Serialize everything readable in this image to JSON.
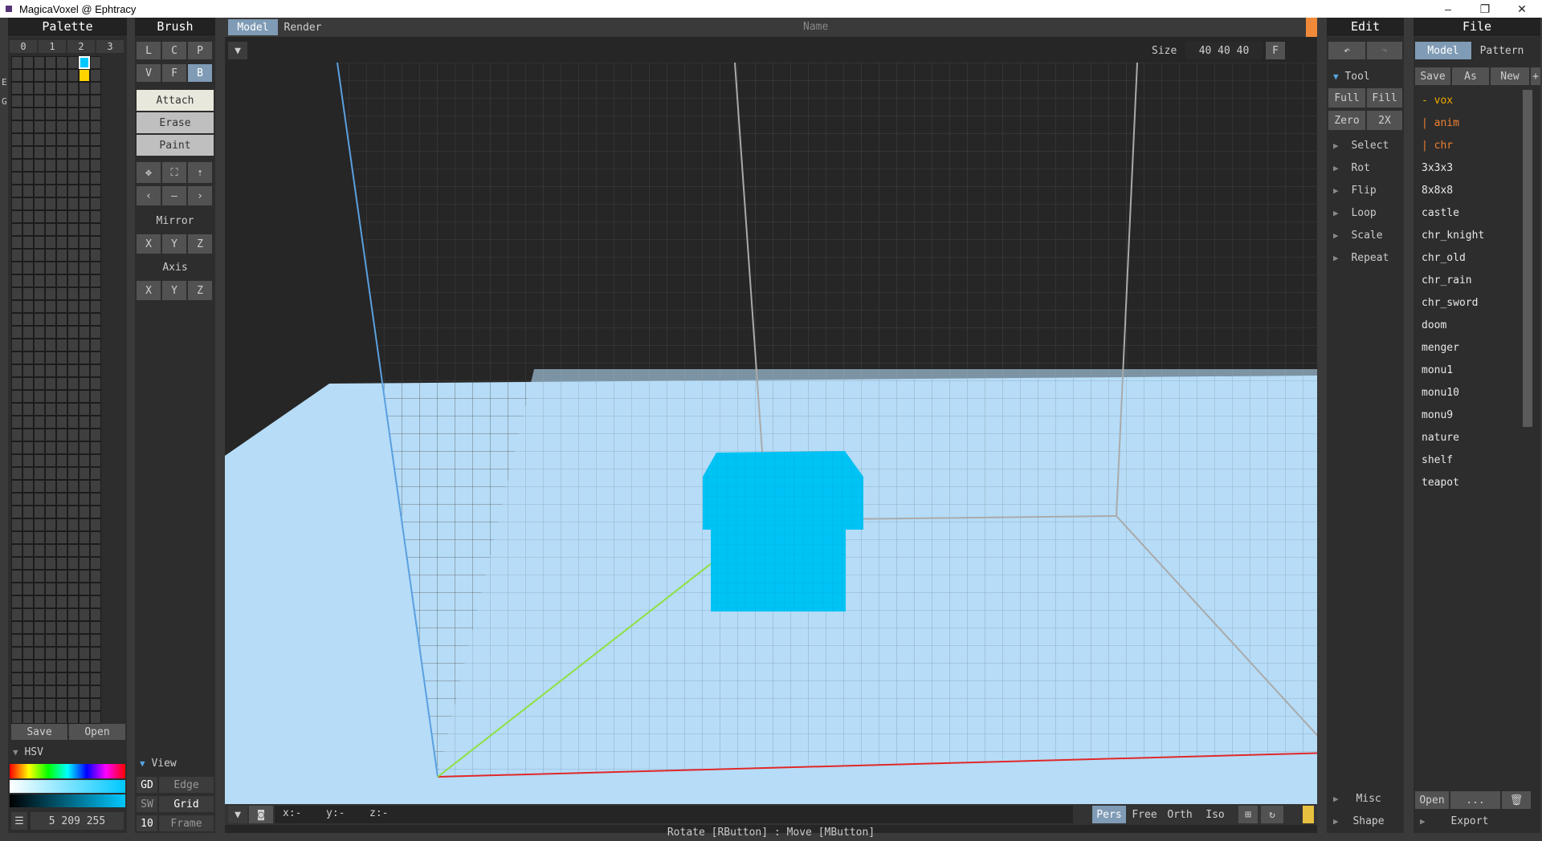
{
  "app": {
    "title": "MagicaVoxel @ Ephtracy"
  },
  "palette": {
    "header": "Palette",
    "tabs": [
      "0",
      "1",
      "2",
      "3"
    ],
    "side_letters": [
      "E",
      "G"
    ],
    "save": "Save",
    "open": "Open",
    "hsv": "HSV",
    "color_value": "5 209 255",
    "selected_colors": [
      "#00c8ff",
      "#ffd200"
    ]
  },
  "brush": {
    "header": "Brush",
    "row1": [
      "L",
      "C",
      "P"
    ],
    "row2": [
      "V",
      "F",
      "B"
    ],
    "modes": [
      "Attach",
      "Erase",
      "Paint"
    ],
    "mirror": "Mirror",
    "axis": "Axis",
    "xyz": [
      "X",
      "Y",
      "Z"
    ],
    "view": "View",
    "gd": "GD",
    "edge": "Edge",
    "sw": "SW",
    "grid": "Grid",
    "frame_num": "10",
    "frame": "Frame"
  },
  "viewport": {
    "tabs": [
      "Model",
      "Render"
    ],
    "name": "Name",
    "size_label": "Size",
    "size": "40 40 40",
    "f": "F",
    "coords": [
      "x:-",
      "y:-",
      "z:-"
    ],
    "proj": [
      "Pers",
      "Free",
      "Orth",
      "Iso"
    ],
    "status": "Rotate [RButton] : Move [MButton]",
    "model_color": "#00c3f5"
  },
  "edit": {
    "header": "Edit",
    "tool": "Tool",
    "full": "Full",
    "fill": "Fill",
    "zero": "Zero",
    "x2": "2X",
    "items": [
      "Select",
      "Rot",
      "Flip",
      "Loop",
      "Scale",
      "Repeat"
    ],
    "misc": "Misc",
    "shape": "Shape"
  },
  "file": {
    "header": "File",
    "tabs": [
      "Model",
      "Pattern"
    ],
    "actions": [
      "Save",
      "As",
      "New",
      "+"
    ],
    "folder": "- vox",
    "subs": [
      "| anim",
      "| chr"
    ],
    "files": [
      "3x3x3",
      "8x8x8",
      "castle",
      "chr_knight",
      "chr_old",
      "chr_rain",
      "chr_sword",
      "doom",
      "menger",
      "monu1",
      "monu10",
      "monu9",
      "nature",
      "shelf",
      "teapot"
    ],
    "open": "Open",
    "dots": "...",
    "export": "Export"
  }
}
